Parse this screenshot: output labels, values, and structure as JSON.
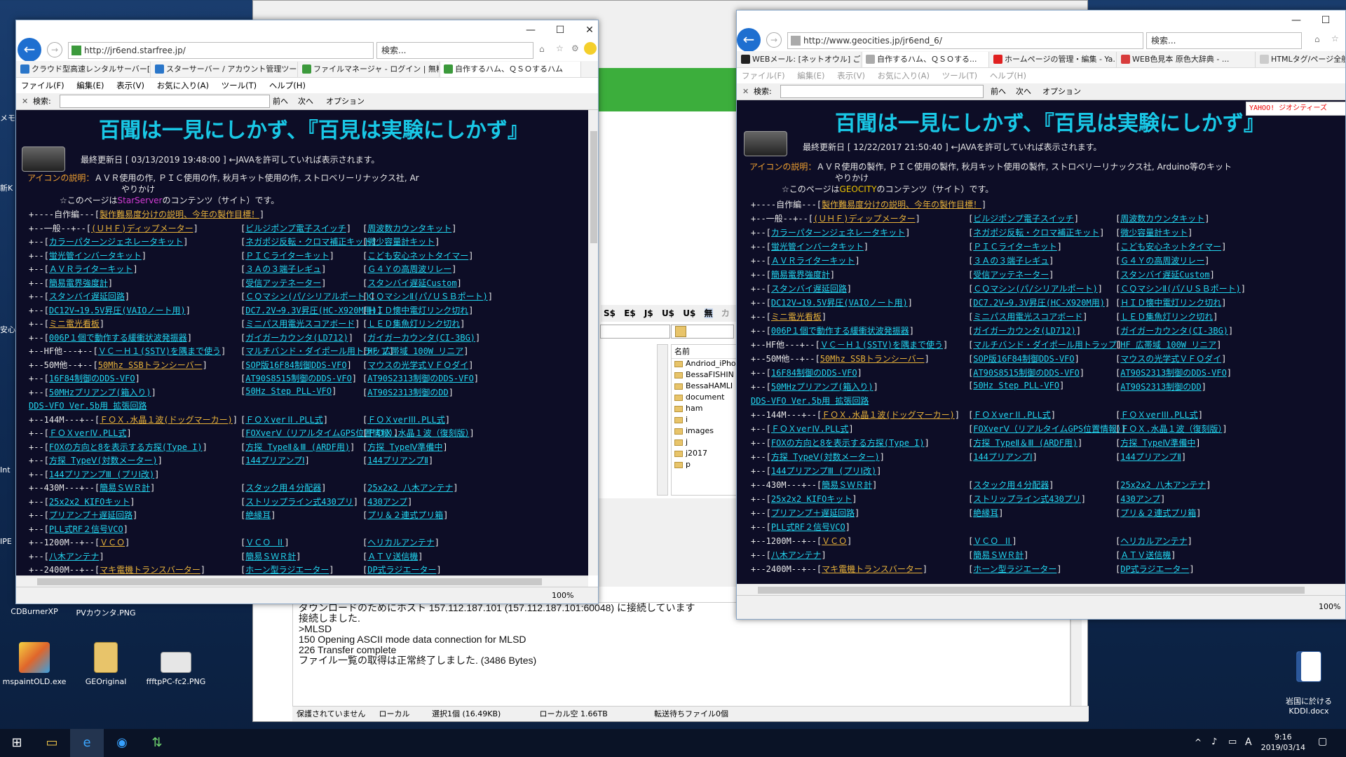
{
  "desktop": {
    "left_labels": [
      "メモ",
      "新K",
      "安心",
      "Int",
      "IPE"
    ],
    "icons": [
      {
        "label": "CDBurnerXP",
        "icon": "cd-icon"
      },
      {
        "label": "PVカウンタ.PNG",
        "icon": "image-icon"
      },
      {
        "label": "mspaintOLD.exe",
        "icon": "paint-icon"
      },
      {
        "label": "GEOriginal",
        "icon": "folder-icon"
      },
      {
        "label": "ffftpPC-fc2.PNG",
        "icon": "image-icon"
      },
      {
        "label": "岩国に於ける\nKDDI.docx",
        "icon": "word-icon"
      }
    ]
  },
  "ffftp": {
    "toolbar": [
      "S$",
      "E$",
      "J$",
      "U$",
      "U$",
      "無",
      "カ"
    ],
    "list_header": "名前",
    "folders": [
      "Andriod_iPho",
      "BessaFISHIN",
      "BessaHAMLI",
      "document",
      "ham",
      "i",
      "images",
      "j",
      "j2017",
      "p"
    ],
    "log": [
      "ダウンロードのためにホスト 157.112.187.101 (157.112.187.101:60048) に接続しています",
      "接続しました.",
      ">MLSD",
      "150 Opening ASCII mode data connection for MLSD",
      "226 Transfer complete",
      "ファイル一覧の取得は正常終了しました. (3486 Bytes)"
    ],
    "status": [
      "保護されていません",
      "ローカル",
      "選択1個 (16.49KB)",
      "ローカル空 1.66TB",
      "転送待ちファイル0個"
    ]
  },
  "left_browser": {
    "controls": {
      "minimize": "—",
      "maximize": "☐",
      "close": "✕"
    },
    "url": "http://jr6end.starfree.jp/",
    "search_placeholder": "検索...",
    "tabs": [
      "クラウド型高速レンタルサーバー[ス...",
      "スターサーバー / アカウント管理ツール",
      "ファイルマネージャ - ログイン | 無料...",
      "自作するハム、ＱＳＯするハム"
    ],
    "menu": [
      "ファイル(F)",
      "編集(E)",
      "表示(V)",
      "お気に入り(A)",
      "ツール(T)",
      "ヘルプ(H)"
    ],
    "find": {
      "label": "検索:",
      "prev": "前へ",
      "next": "次へ",
      "options": "オプション"
    },
    "zoom": "100%",
    "page": {
      "title": "百聞は一見にしかず、『百見は実験にしかず』",
      "updated_prefix": "最終更新日 [ 03/13/2019 19:48:00 ] ←JAVAを許可していれば表示されます。",
      "icon_explain": "アイコンの説明：",
      "icon_explain_rest": "ＡＶＲ使用の作,  ＰＩＣ使用の作,   秋月キット使用の作,  ストロベリーリナックス社, Ar",
      "yarikake": "やりかけ",
      "content_of": "☆このページは",
      "server_name": "StarServer",
      "content_tail": "のコンテンツ（サイト）です。",
      "lines": [
        {
          "prefix": "+----自作編---[",
          "link": "製作難易度分けの説明、今年の製作目標！",
          "suffix": "]",
          "cls": "yel"
        },
        {
          "prefix": "+--一般--+--[",
          "link": "(ＵＨＦ)ディップメーター",
          "suffix": "]",
          "cls": "yel",
          "c2": "ビルジポンプ電子スイッチ",
          "c3": "周波数カウンタキット"
        },
        {
          "prefix": "      +--[",
          "link": "カラーパターンジェネレータキット",
          "suffix": "]",
          "cls": "cy",
          "c2": "ネガポジ反転・クロマ補正キット",
          "c3": "微少容量計キット"
        },
        {
          "prefix": "      +--[",
          "link": "蛍光管インバータキット",
          "suffix": "]",
          "cls": "cy",
          "c2": "ＰＩＣライターキット",
          "c3": "こども安心ネットタイマー"
        },
        {
          "prefix": "      +--[",
          "link": "ＡＶＲライターキット",
          "suffix": "]",
          "cls": "cy",
          "c2": "３Ａの３端子レギュ",
          "c3": "Ｇ４Ｙの高周波リレー"
        },
        {
          "prefix": "      +--[",
          "link": "簡易電界強度計",
          "suffix": "]",
          "cls": "cy",
          "c2": "受信アッテネーター",
          "c3": "スタンバイ遅延Custom"
        },
        {
          "prefix": "      +--[",
          "link": "スタンバイ遅延回路",
          "suffix": "]",
          "cls": "cy",
          "c2": "ＣＱマシン(パ/シリアルポート)",
          "c3": "ＣＱマシンⅡ(パ/ＵＳＢポート)"
        },
        {
          "prefix": "      +--[",
          "link": "DC12V→19.5V昇圧(VAIOノート用)",
          "suffix": "]",
          "cls": "cy",
          "c2": "DC7.2V→9.3V昇圧(HC-X920M用)",
          "c3": "ＨＩＤ懐中電灯リンク切れ"
        },
        {
          "prefix": "      +--[",
          "link": "ミニ電光看板",
          "suffix": "]",
          "cls": "yel",
          "c2": "ミニパス用電光スコアボード",
          "c3": "ＬＥＤ集魚灯リンク切れ"
        },
        {
          "prefix": "      +--[",
          "link": "006P１個で動作する緩衝状波発振器",
          "suffix": "]",
          "cls": "cy",
          "c2": "ガイガーカウンタ(LD712)",
          "c3": "ガイガーカウンタ(CI-3BG)"
        },
        {
          "prefix": "+--HF他---+--[",
          "link": "ＶＣ－Ｈ１(SSTV)を隅まで使う",
          "suffix": "]",
          "cls": "cy",
          "c2": "マルチバンド・ダイポール用トラップ",
          "c3": "HF 広帯域 100W リニア"
        },
        {
          "prefix": "+--50M他--+--[",
          "link": "50Mhz SSBトランシーバー",
          "suffix": "]",
          "cls": "yel",
          "c2": "SOP版16F84制御DDS-VFO",
          "c3": "マウスの光学式ＶＦＯダイ"
        },
        {
          "prefix": "      +--[",
          "link": "16F84制御のDDS-VFO",
          "suffix": "]",
          "cls": "cy",
          "c2": "AT90S8515制御のDDS-VFO",
          "c3": "AT90S2313制御のDDS-VFO"
        },
        {
          "prefix": "      +--[",
          "link": "50MHzプリアンプ(箱入り)",
          "suffix": "]",
          "cls": "cy",
          "c2": "50Hz Step PLL-VFO",
          "c3": "AT90S2313制御のDD"
        },
        {
          "prefix": "",
          "link": "DDS-VFO Ver.5b用 拡張回路",
          "suffix": "",
          "cls": "cy"
        },
        {
          "prefix": "+--144M---+--[",
          "link": "ＦＯＸ.水晶１波(ドッグマーカー)",
          "suffix": "]",
          "cls": "yel",
          "c2": "ＦＯＸverⅡ.PLL式",
          "c3": "ＦＯＸverⅢ.PLL式"
        },
        {
          "prefix": "      +--[",
          "link": "ＦＯＸverⅣ.PLL式",
          "suffix": "]",
          "cls": "cy",
          "c2": "FOXverⅤ（リアルタイムGPS位置情報）",
          "c3": "ＦＯＸ.水晶１波（復刻版）"
        },
        {
          "prefix": "      +--[",
          "link": "FOXの方向と8を表示する方探(Type I)",
          "suffix": "]",
          "cls": "cy",
          "c2": "方探 TypeⅡ＆Ⅲ (ARDF用)",
          "c3": "方探 TypeⅣ準備中"
        },
        {
          "prefix": "      +--[",
          "link": "方探 TypeⅤ(対数メーター)",
          "suffix": "]",
          "cls": "cy",
          "c2": "144プリアンプⅠ",
          "c3": "144プリアンプⅡ"
        },
        {
          "prefix": "      +--[",
          "link": "144プリアンプⅢ (プリⅠ改)",
          "suffix": "]",
          "cls": "cy"
        },
        {
          "prefix": "+--430M---+--[",
          "link": "簡易ＳＷＲ計",
          "suffix": "]",
          "cls": "cy",
          "c2": "スタック用４分配器",
          "c3": "25x2x2 八木アンテナ"
        },
        {
          "prefix": "      +--[",
          "link": "25x2x2 KIFOキット",
          "suffix": "]",
          "cls": "cy",
          "c2": "ストリップライン式430プリ",
          "c3": "430アンプ"
        },
        {
          "prefix": "      +--[",
          "link": "プリアンプ＋遅延回路",
          "suffix": "]",
          "cls": "cy",
          "c2": "絶縁耳",
          "c3": "プリ＆２連式プリ箱"
        },
        {
          "prefix": "      +--[",
          "link": "PLL式RF２信号VCO",
          "suffix": "]",
          "cls": "cy"
        },
        {
          "prefix": "+--1200M--+--[",
          "link": "ＶＣＯ",
          "suffix": "]",
          "cls": "yel",
          "c2": "ＶＣＯ Ⅱ",
          "c3": "ヘリカルアンテナ"
        },
        {
          "prefix": "      +--[",
          "link": "八木アンテナ",
          "suffix": "]",
          "cls": "cy",
          "c2": "簡易ＳＷＲ計",
          "c3": "ＡＴＶ送信機"
        },
        {
          "prefix": "+--2400M--+--[",
          "link": "マキ電機トランスバーター",
          "suffix": "]",
          "cls": "yel",
          "c2": "ホーン型ラジエーター",
          "c3": "DP式ラジエーター"
        }
      ]
    }
  },
  "right_browser": {
    "controls": {
      "minimize": "—",
      "maximize": "☐",
      "close": "✕"
    },
    "url": "http://www.geocities.jp/jr6end_6/",
    "search_placeholder": "検索...",
    "tabs": [
      "WEBメール: [ネットオウル] ご登...",
      "自作するハム、ＱＳＯする...",
      "ホームページの管理・編集 - Ya...",
      "WEB色見本 原色大辞典 - ...",
      "HTMLタグ/ページ全般タグ/..."
    ],
    "menu": [
      "ファイル(F)",
      "編集(E)",
      "表示(V)",
      "お気に入り(A)",
      "ツール(T)",
      "ヘルプ(H)"
    ],
    "find": {
      "label": "検索:",
      "prev": "前へ",
      "next": "次へ",
      "options": "オプション"
    },
    "zoom": "100%",
    "yahoo_badge": "YAHOO! ジオシティーズ",
    "page": {
      "title": "百聞は一見にしかず、『百見は実験にしかず』",
      "updated_prefix": "最終更新日 [ 12/22/2017 21:50:40 ] ←JAVAを許可していれば表示されます。",
      "icon_explain": "アイコンの説明：",
      "icon_explain_rest": "ＡＶＲ使用の製作, ＰＩＣ使用の製作, 秋月キット使用の製作, ストロベリーリナックス社, Arduino等のキット",
      "yarikake": "やりかけ",
      "content_of": "☆このページは",
      "server_name": "GEOCITY",
      "content_tail": "のコンテンツ（サイト）です。"
    }
  },
  "taskbar": {
    "time": "9:16",
    "date": "2019/03/14",
    "ime": "A"
  }
}
